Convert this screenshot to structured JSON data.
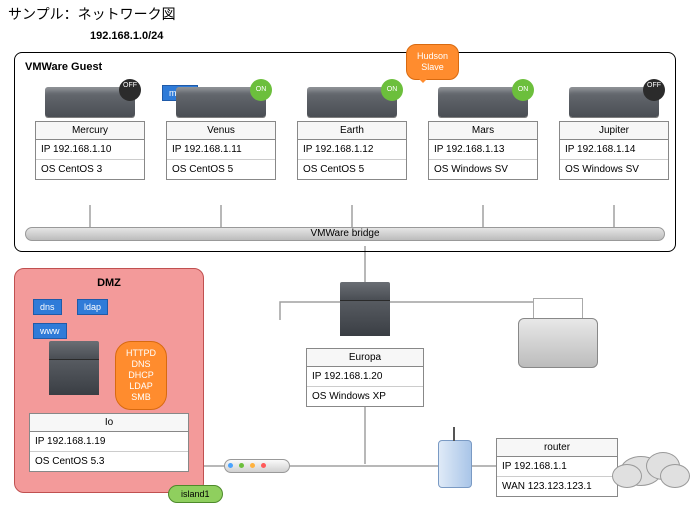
{
  "title": "サンプル：ネットワーク図",
  "subnet": "192.168.1.0/24",
  "vmware_guest_label": "VMWare Guest",
  "bridge_label": "VMWare bridge",
  "hudson_bubble": "Hudson\nSlave",
  "mint_sticky": "mint1",
  "guests": [
    {
      "name": "Mercury",
      "ip": "IP 192.168.1.10",
      "os": "OS CentOS 3",
      "power": "OFF"
    },
    {
      "name": "Venus",
      "ip": "IP 192.168.1.11",
      "os": "OS CentOS 5",
      "power": "ON"
    },
    {
      "name": "Earth",
      "ip": "IP 192.168.1.12",
      "os": "OS CentOS 5",
      "power": "ON"
    },
    {
      "name": "Mars",
      "ip": "IP 192.168.1.13",
      "os": "OS Windows SV",
      "power": "ON"
    },
    {
      "name": "Jupiter",
      "ip": "IP 192.168.1.14",
      "os": "OS Windows SV",
      "power": "OFF"
    }
  ],
  "dmz": {
    "label": "DMZ",
    "stickies": [
      "dns",
      "ldap",
      "www"
    ],
    "services_bubble": "HTTPD\nDNS\nDHCP\nLDAP\nSMB",
    "host": {
      "name": "Io",
      "ip": "IP 192.168.1.19",
      "os": "OS CentOS 5.3"
    },
    "island": "island1"
  },
  "europa": {
    "name": "Europa",
    "ip": "IP 192.168.1.20",
    "os": "OS Windows XP"
  },
  "router": {
    "name": "router",
    "ip": "IP 192.168.1.1",
    "wan": "WAN 123.123.123.1"
  }
}
